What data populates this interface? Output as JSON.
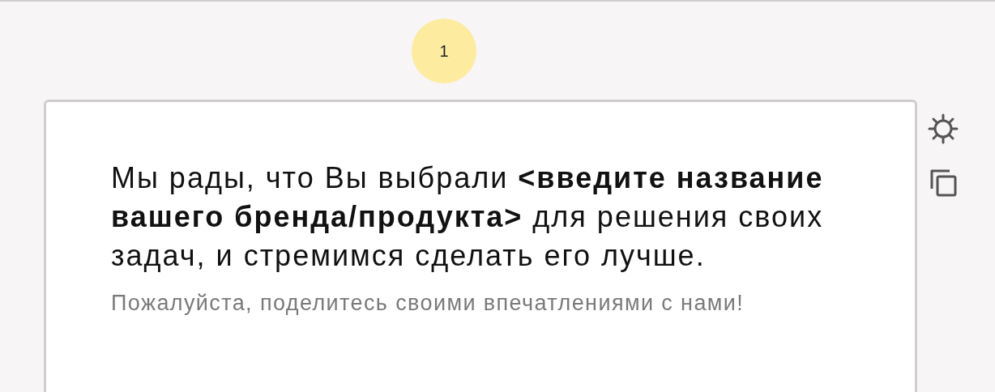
{
  "step": {
    "number": "1"
  },
  "card": {
    "message": "Мы рады, что Вы выбрали **<введите название вашего бренда/продукта>** для решения своих задач, и стремимся сделать его лучше.",
    "note": "Пожалуйста, поделитесь своими впечатлениями с нами!"
  }
}
